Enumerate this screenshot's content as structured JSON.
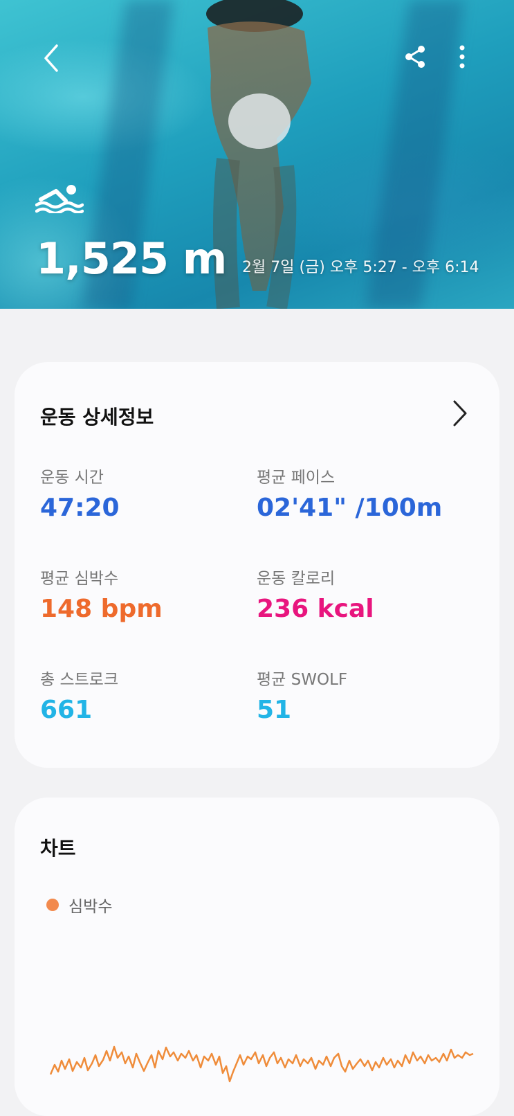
{
  "header": {
    "distance": "1,525 m",
    "datetime": "2월 7일 (금) 오후 5:27 - 오후 6:14"
  },
  "icons": {
    "back": "chevron-left-icon",
    "share": "share-icon",
    "more": "more-vertical-icon",
    "activity": "swimming-icon",
    "detail": "chevron-right-icon"
  },
  "details": {
    "title": "운동 상세정보",
    "stats": [
      {
        "label": "운동 시간",
        "value": "47:20",
        "color": "#2b66d9"
      },
      {
        "label": "평균 페이스",
        "value": "02'41\" /100m",
        "color": "#2b66d9"
      },
      {
        "label": "평균 심박수",
        "value": "148 bpm",
        "color": "#ee6a2c"
      },
      {
        "label": "운동 칼로리",
        "value": "236 kcal",
        "color": "#e8157e"
      },
      {
        "label": "총 스트로크",
        "value": "661",
        "color": "#22b4e6"
      },
      {
        "label": "평균 SWOLF",
        "value": "51",
        "color": "#22b4e6"
      }
    ]
  },
  "chart": {
    "title": "차트",
    "legend": "심박수",
    "legend_color": "#f28a4e"
  }
}
